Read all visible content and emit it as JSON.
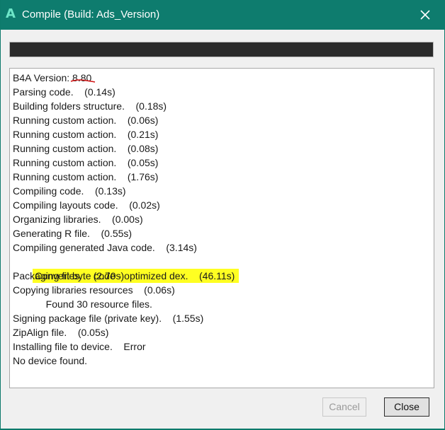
{
  "window": {
    "app_icon": "A",
    "title": "Compile (Build: Ads_Version)",
    "close_icon": "close-icon",
    "accent_color": "#0e7c6e"
  },
  "progress": {
    "percent": 100,
    "color": "#2b2b2b"
  },
  "log": {
    "lines": [
      "B4A Version: 8.80",
      "Parsing code.    (0.14s)",
      "Building folders structure.    (0.18s)",
      "Running custom action.    (0.06s)",
      "Running custom action.    (0.21s)",
      "Running custom action.    (0.08s)",
      "Running custom action.    (0.05s)",
      "Running custom action.    (1.76s)",
      "Compiling code.    (0.13s)",
      "Compiling layouts code.    (0.02s)",
      "Organizing libraries.    (0.00s)",
      "Generating R file.    (0.55s)",
      "Compiling generated Java code.    (3.14s)",
      "Convert byte code - optimized dex.    (46.11s)",
      "Packaging files.    (2.70s)",
      "Copying libraries resources    (0.06s)",
      "            Found 30 resource files.",
      "Signing package file (private key).    (1.55s)",
      "ZipAlign file.    (0.05s)",
      "Installing file to device.    Error",
      "No device found."
    ],
    "highlight_color": "#ffff22",
    "underline_color": "#d01010"
  },
  "buttons": {
    "cancel_label": "Cancel",
    "close_label": "Close"
  }
}
